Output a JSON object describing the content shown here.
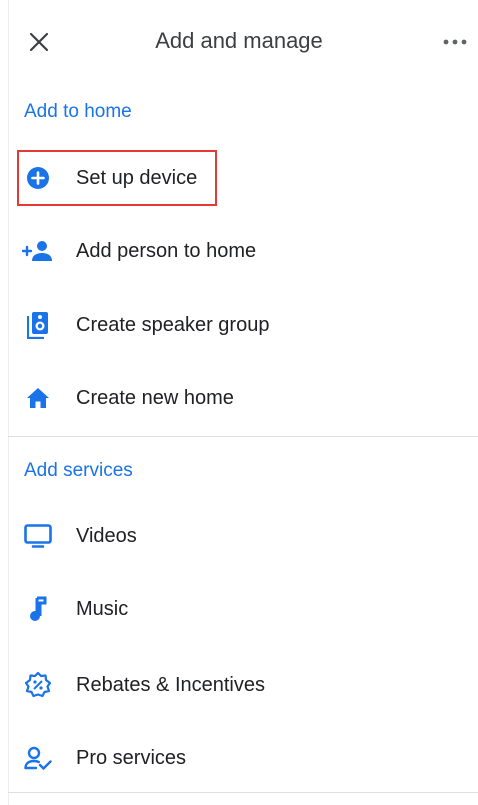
{
  "header": {
    "title": "Add and manage"
  },
  "sections": {
    "home": {
      "title": "Add to home",
      "items": [
        {
          "label": "Set up device",
          "icon": "add-circle-icon"
        },
        {
          "label": "Add person to home",
          "icon": "add-person-icon"
        },
        {
          "label": "Create speaker group",
          "icon": "speaker-icon"
        },
        {
          "label": "Create new home",
          "icon": "home-icon"
        }
      ]
    },
    "services": {
      "title": "Add services",
      "items": [
        {
          "label": "Videos",
          "icon": "tv-icon"
        },
        {
          "label": "Music",
          "icon": "music-note-icon"
        },
        {
          "label": "Rebates & Incentives",
          "icon": "rebate-badge-icon"
        },
        {
          "label": "Pro services",
          "icon": "person-check-icon"
        }
      ]
    }
  },
  "colors": {
    "accent": "#1a73e8",
    "highlight": "#e53935",
    "text": "#202124"
  }
}
